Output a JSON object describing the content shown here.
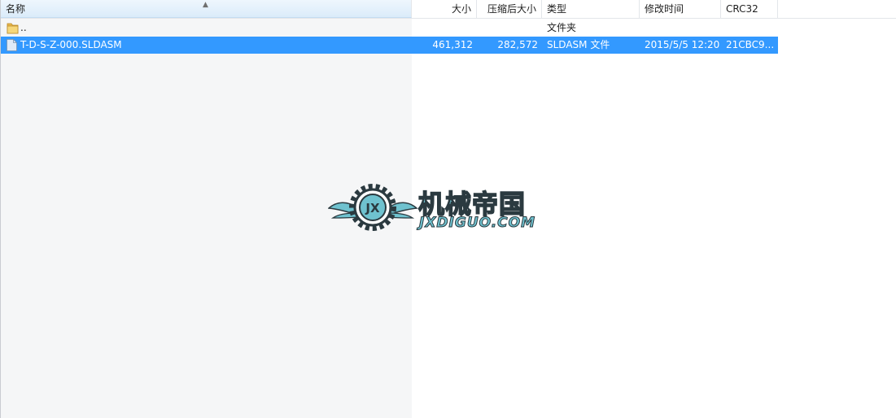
{
  "header": {
    "columns": [
      {
        "key": "name",
        "label": "名称"
      },
      {
        "key": "size",
        "label": "大小"
      },
      {
        "key": "packed",
        "label": "压缩后大小"
      },
      {
        "key": "type",
        "label": "类型"
      },
      {
        "key": "modified",
        "label": "修改时间"
      },
      {
        "key": "crc",
        "label": "CRC32"
      }
    ]
  },
  "rows": [
    {
      "icon": "folder-icon",
      "name": "..",
      "size": "",
      "packed": "",
      "type": "文件夹",
      "modified": "",
      "crc": ""
    },
    {
      "icon": "document-icon",
      "name": "T-D-S-Z-000.SLDASM",
      "size": "461,312",
      "packed": "282,572",
      "type": "SLDASM 文件",
      "modified": "2015/5/5 12:20",
      "crc": "21CBC9..."
    }
  ],
  "watermark": {
    "emblem_text": "JX",
    "title": "机械帝国",
    "subtitle": "JXDIGUO.COM"
  },
  "colors": {
    "selection": "#3399ff",
    "accent": "#6fc2cf"
  }
}
